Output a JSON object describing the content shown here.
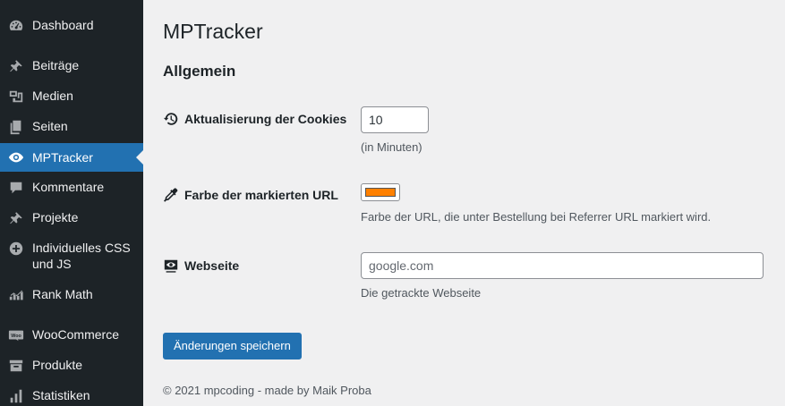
{
  "sidebar": {
    "items": [
      {
        "label": "Dashboard",
        "icon": "dashboard-icon"
      },
      {
        "label": "Beiträge",
        "icon": "pin-icon"
      },
      {
        "label": "Medien",
        "icon": "media-icon"
      },
      {
        "label": "Seiten",
        "icon": "pages-icon"
      },
      {
        "label": "MPTracker",
        "icon": "eye-icon",
        "current": true
      },
      {
        "label": "Kommentare",
        "icon": "comment-icon"
      },
      {
        "label": "Projekte",
        "icon": "pin-icon"
      },
      {
        "label": "Individuelles CSS und JS",
        "icon": "plus-circle-icon"
      },
      {
        "label": "Rank Math",
        "icon": "rank-math-icon"
      },
      {
        "label": "WooCommerce",
        "icon": "woo-icon"
      },
      {
        "label": "Produkte",
        "icon": "archive-icon"
      },
      {
        "label": "Statistiken",
        "icon": "bar-chart-icon"
      }
    ]
  },
  "page": {
    "title": "MPTracker",
    "section_title": "Allgemein"
  },
  "settings": {
    "cookies": {
      "label": "Aktualisierung der Cookies",
      "value": "10",
      "description": "(in Minuten)",
      "icon": "history-icon"
    },
    "color": {
      "label": "Farbe der markierten URL",
      "value": "#ff8000",
      "description": "Farbe der URL, die unter Bestellung bei Referrer URL markiert wird.",
      "icon": "eyedropper-icon"
    },
    "website": {
      "label": "Webseite",
      "value": "",
      "placeholder": "google.com",
      "description": "Die getrackte Webseite",
      "icon": "screen-eye-icon"
    }
  },
  "actions": {
    "save_label": "Änderungen speichern"
  },
  "footer": {
    "text": "© 2021 mpcoding - made by Maik Proba"
  },
  "colors": {
    "sidebar_bg": "#1d2327",
    "accent": "#2271b1",
    "page_bg": "#f0f0f1"
  }
}
